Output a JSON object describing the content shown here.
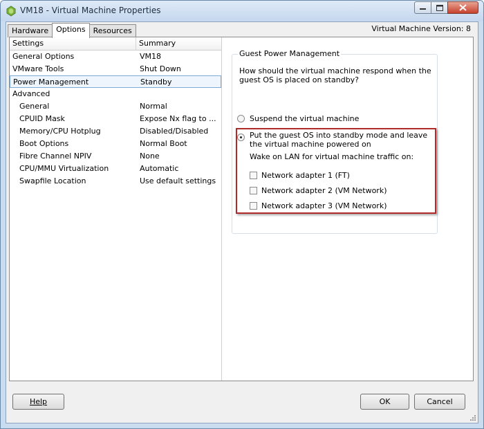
{
  "window": {
    "title": "VM18 - Virtual Machine Properties",
    "controls": [
      "minimize-icon",
      "maximize-icon",
      "close-icon"
    ]
  },
  "tabs": [
    "Hardware",
    "Options",
    "Resources"
  ],
  "active_tab": "Options",
  "vm_version": "Virtual Machine Version: 8",
  "settings_list": {
    "header": {
      "settings": "Settings",
      "summary": "Summary"
    },
    "rows": [
      {
        "setting": "General Options",
        "summary": "VM18"
      },
      {
        "setting": "VMware Tools",
        "summary": "Shut Down"
      },
      {
        "setting": "Power Management",
        "summary": "Standby"
      },
      {
        "setting": "Advanced",
        "summary": ""
      },
      {
        "setting": "General",
        "summary": "Normal"
      },
      {
        "setting": "CPUID Mask",
        "summary": "Expose Nx flag to ..."
      },
      {
        "setting": "Memory/CPU Hotplug",
        "summary": "Disabled/Disabled"
      },
      {
        "setting": "Boot Options",
        "summary": "Normal Boot"
      },
      {
        "setting": "Fibre Channel NPIV",
        "summary": "None"
      },
      {
        "setting": "CPU/MMU Virtualization",
        "summary": "Automatic"
      },
      {
        "setting": "Swapfile Location",
        "summary": "Use default settings"
      }
    ],
    "selected": "Power Management"
  },
  "power_management": {
    "group_title": "Guest Power Management",
    "question": "How should the virtual machine respond when the guest OS is placed on standby?",
    "option_suspend": "Suspend the virtual machine",
    "option_standby": "Put the guest OS into standby mode and leave the virtual machine powered on",
    "selected_option": "standby",
    "wake_on_lan_label": "Wake on LAN for virtual machine traffic on:",
    "adapters": [
      {
        "label": "Network adapter 1 (FT)",
        "checked": false
      },
      {
        "label": "Network adapter 2 (VM Network)",
        "checked": false
      },
      {
        "label": "Network adapter 3 (VM Network)",
        "checked": false
      }
    ]
  },
  "buttons": {
    "help": "Help",
    "ok": "OK",
    "cancel": "Cancel"
  },
  "colors": {
    "highlight_border": "#b02a2a",
    "selection_border": "#7fa9d6"
  }
}
